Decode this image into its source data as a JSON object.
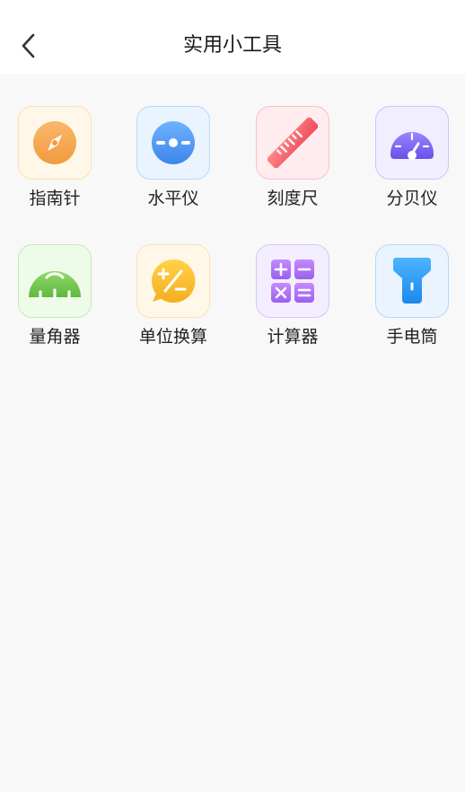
{
  "header": {
    "title": "实用小工具",
    "back_icon": "chevron-left-icon"
  },
  "tools": [
    {
      "label": "指南针",
      "icon": "compass-icon",
      "tile_bg": "#fff8e8",
      "tile_border": "#fbe2b4",
      "accent": "#f8a64c"
    },
    {
      "label": "水平仪",
      "icon": "level-icon",
      "tile_bg": "#eaf4ff",
      "tile_border": "#b7d9f7",
      "accent": "#4c9cf4"
    },
    {
      "label": "刻度尺",
      "icon": "ruler-icon",
      "tile_bg": "#ffecee",
      "tile_border": "#f7c1c7",
      "accent": "#f0525f"
    },
    {
      "label": "分贝仪",
      "icon": "decibel-meter-icon",
      "tile_bg": "#f1eeff",
      "tile_border": "#cec4f7",
      "accent": "#7c62ef"
    },
    {
      "label": "量角器",
      "icon": "protractor-icon",
      "tile_bg": "#eefbe8",
      "tile_border": "#c4ebb1",
      "accent": "#6fc24a"
    },
    {
      "label": "单位换算",
      "icon": "unit-conversion-icon",
      "tile_bg": "#fff8e8",
      "tile_border": "#fbe2b4",
      "accent": "#f8bb2e"
    },
    {
      "label": "计算器",
      "icon": "calculator-icon",
      "tile_bg": "#f3eeff",
      "tile_border": "#d6c6f7",
      "accent": "#b075f0"
    },
    {
      "label": "手电筒",
      "icon": "flashlight-icon",
      "tile_bg": "#eaf4ff",
      "tile_border": "#b7d9f7",
      "accent": "#2f9ff4"
    }
  ]
}
